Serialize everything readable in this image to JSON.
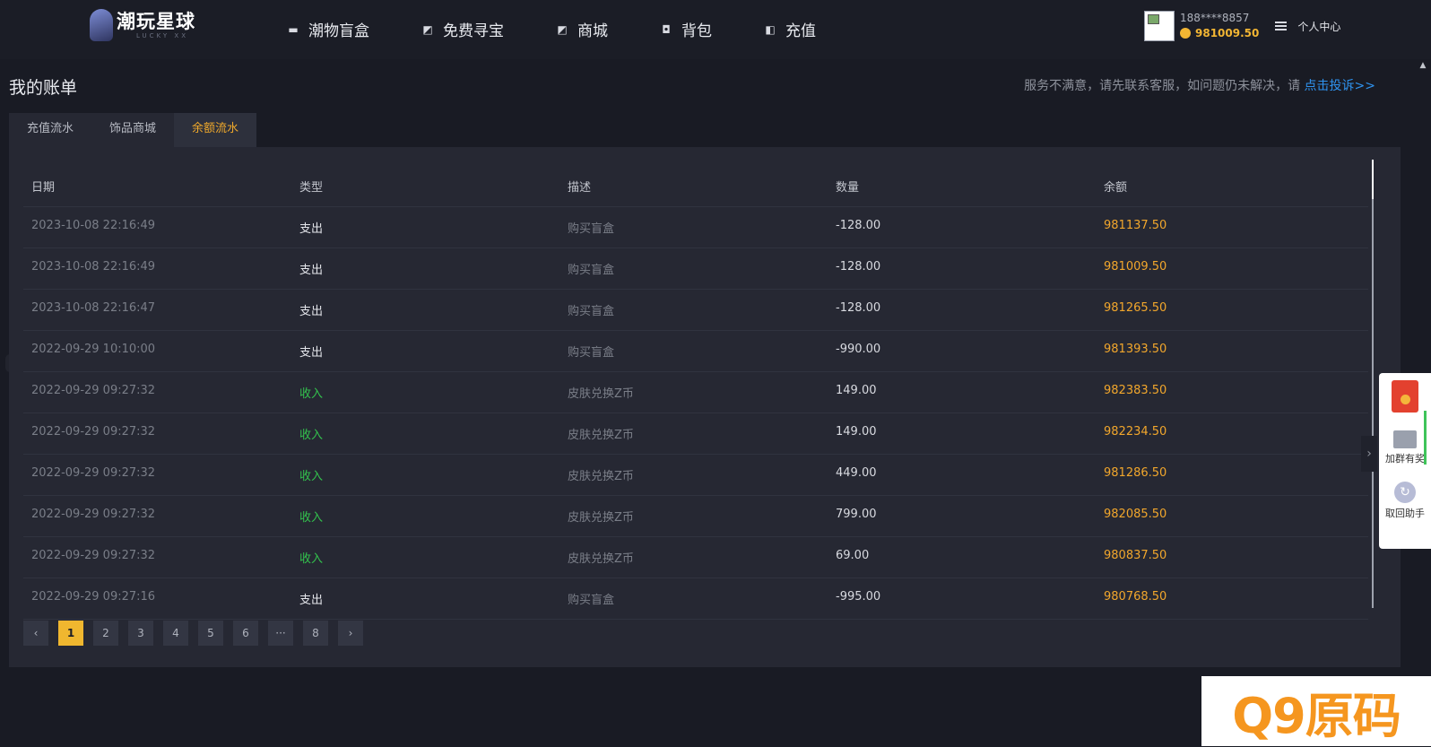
{
  "header": {
    "brand": "潮玩星球",
    "brand_sub": "LUCKY XX",
    "nav": [
      {
        "label": "潮物盲盒",
        "icon": "box-icon"
      },
      {
        "label": "免费寻宝",
        "icon": "image-icon"
      },
      {
        "label": "商城",
        "icon": "image-icon"
      },
      {
        "label": "背包",
        "icon": "bag-icon"
      },
      {
        "label": "充值",
        "icon": "wallet-icon"
      }
    ],
    "user": {
      "phone": "188****8857",
      "balance": "981009.50",
      "center_label": "个人中心"
    }
  },
  "page": {
    "title": "我的账单",
    "notice": "服务不满意，请先联系客服，如问题仍未解决，请",
    "complaint_link": "点击投诉>>"
  },
  "tabs": [
    {
      "label": "充值流水",
      "active": false
    },
    {
      "label": "饰品商城",
      "active": false
    },
    {
      "label": "余额流水",
      "active": true
    }
  ],
  "table": {
    "columns": [
      "日期",
      "类型",
      "描述",
      "数量",
      "余额"
    ],
    "rows": [
      {
        "date": "2023-10-08 22:16:49",
        "type": "支出",
        "desc": "购买盲盒",
        "qty": "-128.00",
        "balance": "981137.50"
      },
      {
        "date": "2023-10-08 22:16:49",
        "type": "支出",
        "desc": "购买盲盒",
        "qty": "-128.00",
        "balance": "981009.50"
      },
      {
        "date": "2023-10-08 22:16:47",
        "type": "支出",
        "desc": "购买盲盒",
        "qty": "-128.00",
        "balance": "981265.50"
      },
      {
        "date": "2022-09-29 10:10:00",
        "type": "支出",
        "desc": "购买盲盒",
        "qty": "-990.00",
        "balance": "981393.50"
      },
      {
        "date": "2022-09-29 09:27:32",
        "type": "收入",
        "desc": "皮肤兑换Z币",
        "qty": "149.00",
        "balance": "982383.50"
      },
      {
        "date": "2022-09-29 09:27:32",
        "type": "收入",
        "desc": "皮肤兑换Z币",
        "qty": "149.00",
        "balance": "982234.50"
      },
      {
        "date": "2022-09-29 09:27:32",
        "type": "收入",
        "desc": "皮肤兑换Z币",
        "qty": "449.00",
        "balance": "981286.50"
      },
      {
        "date": "2022-09-29 09:27:32",
        "type": "收入",
        "desc": "皮肤兑换Z币",
        "qty": "799.00",
        "balance": "982085.50"
      },
      {
        "date": "2022-09-29 09:27:32",
        "type": "收入",
        "desc": "皮肤兑换Z币",
        "qty": "69.00",
        "balance": "980837.50"
      },
      {
        "date": "2022-09-29 09:27:16",
        "type": "支出",
        "desc": "购买盲盒",
        "qty": "-995.00",
        "balance": "980768.50"
      }
    ]
  },
  "pagination": {
    "prev": "‹",
    "pages": [
      "1",
      "2",
      "3",
      "4",
      "5",
      "6",
      "···",
      "8"
    ],
    "next": "›",
    "current": "1"
  },
  "float_panel": {
    "items": [
      {
        "label": "",
        "icon": "red-packet-icon"
      },
      {
        "label": "加群有奖",
        "icon": "shop-icon"
      },
      {
        "label": "取回助手",
        "icon": "retrieve-icon"
      }
    ]
  },
  "watermark": "Q9原码",
  "colors": {
    "accent": "#f0b72f",
    "balance": "#f2a72c",
    "income": "#33c14d",
    "link": "#2f93ef",
    "background": "#191b24"
  }
}
